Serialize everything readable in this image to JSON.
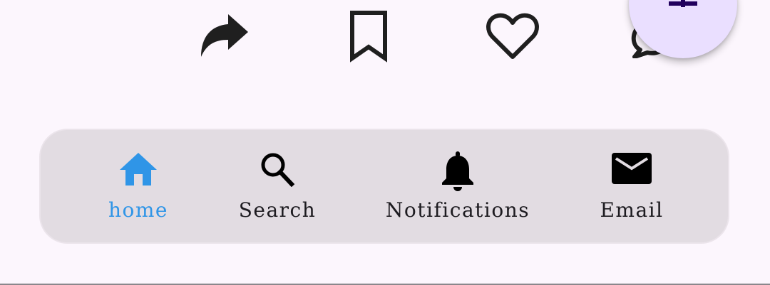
{
  "actions": {
    "share_icon": "share-icon",
    "bookmark_icon": "bookmark-icon",
    "like_icon": "heart-icon",
    "comment_icon": "comment-icon"
  },
  "fab": {
    "icon": "plus-icon",
    "color": "#eadfff"
  },
  "nav": {
    "items": [
      {
        "label": "home",
        "icon": "home-icon",
        "active": true
      },
      {
        "label": "Search",
        "icon": "search-icon",
        "active": false
      },
      {
        "label": "Notifications",
        "icon": "bell-icon",
        "active": false
      },
      {
        "label": "Email",
        "icon": "mail-icon",
        "active": false
      }
    ],
    "active_color": "#2f95e7",
    "background": "#e2dce2"
  },
  "page_background": "#fcf6fd"
}
